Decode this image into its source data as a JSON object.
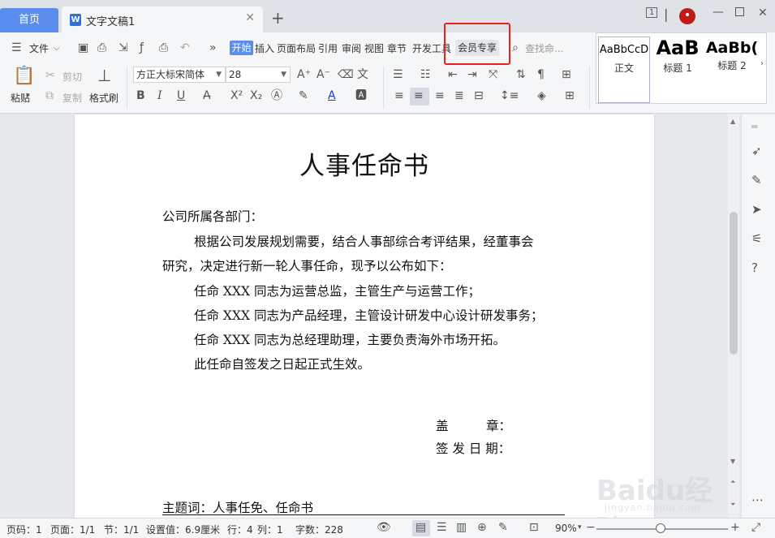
{
  "titlebar": {
    "home_tab": "首页",
    "doc_tab": "文字文稿1",
    "doc_icon": "W",
    "close_glyph": "✕",
    "new_tab_glyph": "+",
    "window_badge": "1"
  },
  "menu": {
    "file": "文件",
    "tabs": [
      "开始",
      "插入",
      "页面布局",
      "引用",
      "审阅",
      "视图",
      "章节",
      "开发工具",
      "会员专享"
    ],
    "search_placeholder": "查找命..."
  },
  "toolbar": {
    "paste": "粘贴",
    "cut": "剪切",
    "copy": "复制",
    "format_painter": "格式刷",
    "font_name": "方正大标宋简体",
    "font_size": "28",
    "bold": "B",
    "italic": "I",
    "underline": "U",
    "font_color_letter": "A"
  },
  "styles": [
    {
      "sample": "AaBbCcD",
      "name": "正文"
    },
    {
      "sample": "AaB",
      "name": "标题 1"
    },
    {
      "sample": "AaBb(",
      "name": "标题 2"
    }
  ],
  "document": {
    "title": "人事任命书",
    "salutation": "公司所属各部门：",
    "para1_line1": "根据公司发展规划需要，结合人事部综合考评结果，经董事会",
    "para1_line2": "研究，决定进行新一轮人事任命，现予以公布如下：",
    "items": [
      "任命 XXX 同志为运营总监，主管生产与运营工作；",
      "任命 XXX 同志为产品经理，主管设计研发中心设计研发事务；",
      "任命 XXX 同志为总经理助理，主要负责海外市场开拓。"
    ],
    "effective": "此任命自签发之日起正式生效。",
    "seal": "盖　　　章：",
    "sign_date": "签 发 日 期：",
    "subject": "主题词：人事任免、任命书"
  },
  "status": {
    "page_num": "页码：1",
    "pages": "页面：1/1",
    "section": "节：1/1",
    "setting": "设置值：6.9厘米",
    "row": "行：4",
    "col": "列：1",
    "words": "字数：228",
    "zoom": "90%"
  },
  "watermark": {
    "brand": "Baidu经验",
    "url": "jingyan.baidu.com"
  },
  "colors": {
    "accent": "#5b8def",
    "highlight_box": "#e8201e"
  }
}
